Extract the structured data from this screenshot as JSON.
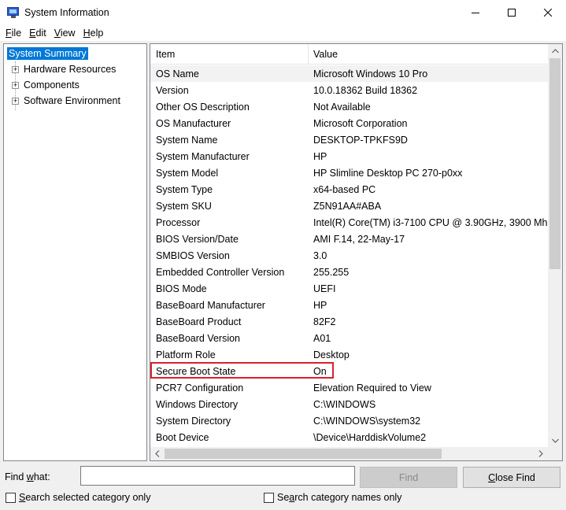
{
  "window": {
    "title": "System Information",
    "minimize_glyph": "—",
    "maximize_glyph": "☐",
    "close_glyph": "✕"
  },
  "menu": [
    {
      "accel": "F",
      "rest": "ile"
    },
    {
      "accel": "E",
      "rest": "dit"
    },
    {
      "accel": "V",
      "rest": "iew"
    },
    {
      "accel": "H",
      "rest": "elp"
    }
  ],
  "tree": {
    "root": "System Summary",
    "children": [
      "Hardware Resources",
      "Components",
      "Software Environment"
    ]
  },
  "list": {
    "columns": {
      "item": "Item",
      "value": "Value"
    },
    "rows": [
      {
        "item": "OS Name",
        "value": "Microsoft Windows 10 Pro"
      },
      {
        "item": "Version",
        "value": "10.0.18362 Build 18362"
      },
      {
        "item": "Other OS Description",
        "value": "Not Available"
      },
      {
        "item": "OS Manufacturer",
        "value": "Microsoft Corporation"
      },
      {
        "item": "System Name",
        "value": "DESKTOP-TPKFS9D"
      },
      {
        "item": "System Manufacturer",
        "value": "HP"
      },
      {
        "item": "System Model",
        "value": "HP Slimline Desktop PC 270-p0xx"
      },
      {
        "item": "System Type",
        "value": "x64-based PC"
      },
      {
        "item": "System SKU",
        "value": "Z5N91AA#ABA"
      },
      {
        "item": "Processor",
        "value": "Intel(R) Core(TM) i3-7100 CPU @ 3.90GHz, 3900 Mh"
      },
      {
        "item": "BIOS Version/Date",
        "value": "AMI F.14, 22-May-17"
      },
      {
        "item": "SMBIOS Version",
        "value": "3.0"
      },
      {
        "item": "Embedded Controller Version",
        "value": "255.255"
      },
      {
        "item": "BIOS Mode",
        "value": "UEFI"
      },
      {
        "item": "BaseBoard Manufacturer",
        "value": "HP"
      },
      {
        "item": "BaseBoard Product",
        "value": "82F2"
      },
      {
        "item": "BaseBoard Version",
        "value": "A01"
      },
      {
        "item": "Platform Role",
        "value": "Desktop"
      },
      {
        "item": "Secure Boot State",
        "value": "On"
      },
      {
        "item": "PCR7 Configuration",
        "value": "Elevation Required to View"
      },
      {
        "item": "Windows Directory",
        "value": "C:\\WINDOWS"
      },
      {
        "item": "System Directory",
        "value": "C:\\WINDOWS\\system32"
      },
      {
        "item": "Boot Device",
        "value": "\\Device\\HarddiskVolume2"
      }
    ],
    "highlighted_item": "Secure Boot State",
    "highlight_color": "#d9212b"
  },
  "find": {
    "label_pre": "Find ",
    "label_accel": "w",
    "label_post": "hat:",
    "input_value": "",
    "find_button": "Find",
    "close_find_accel": "C",
    "close_find_rest": "lose Find",
    "search_selected": {
      "accel": "S",
      "rest": "earch selected category only"
    },
    "search_names": {
      "pre": "Se",
      "accel": "a",
      "rest": "rch category names only"
    }
  }
}
